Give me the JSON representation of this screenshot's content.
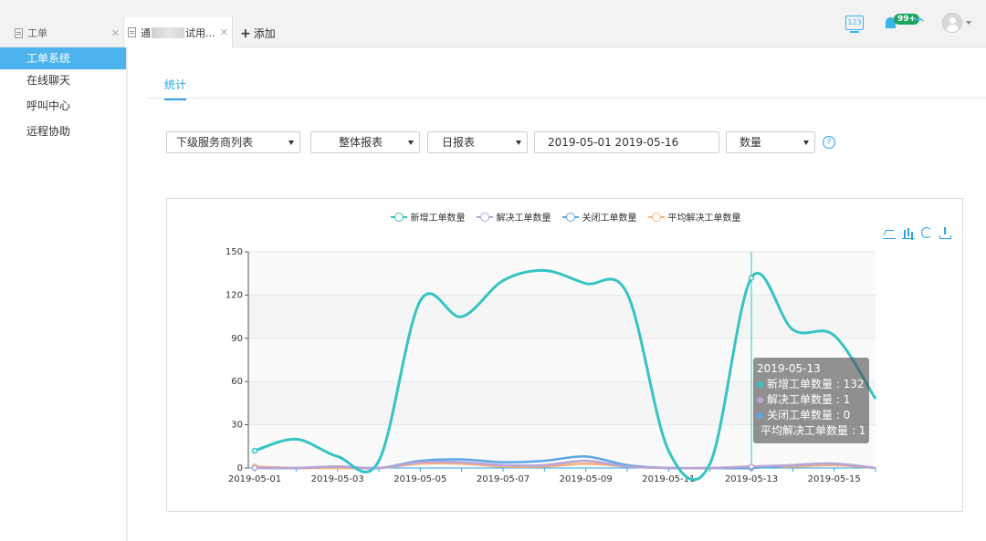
{
  "tabs": [
    {
      "label": "工单",
      "close": "✕"
    },
    {
      "label_prefix": "通",
      "label_suffix": "试用...",
      "close": "✕"
    }
  ],
  "add_tab": {
    "icon": "+",
    "label": "添加"
  },
  "header": {
    "keypad_text": "123",
    "badge": "99+"
  },
  "sidebar": {
    "items": [
      {
        "label": "工单系统",
        "active": true
      },
      {
        "label": "在线聊天"
      },
      {
        "label": "呼叫中心"
      },
      {
        "label": "远程协助"
      }
    ]
  },
  "subtabs": [
    {
      "label": "统计"
    }
  ],
  "filters": {
    "provider": "下级服务商列表",
    "report_scope": "整体报表",
    "report_period": "日报表",
    "date_range": "2019-05-01 2019-05-16",
    "metric": "数量",
    "help": "?"
  },
  "colors": {
    "new": "#36c3c3",
    "resolved": "#b8a4d8",
    "closed": "#5ba7e6",
    "avg": "#f8b07a",
    "accent": "#2ba4e8"
  },
  "chart_data": {
    "type": "line",
    "x": [
      "2019-05-01",
      "2019-05-02",
      "2019-05-03",
      "2019-05-04",
      "2019-05-05",
      "2019-05-06",
      "2019-05-07",
      "2019-05-08",
      "2019-05-09",
      "2019-05-10",
      "2019-05-11",
      "2019-05-12",
      "2019-05-13",
      "2019-05-14",
      "2019-05-15",
      "2019-05-16"
    ],
    "xticks": [
      "2019-05-01",
      "2019-05-03",
      "2019-05-05",
      "2019-05-07",
      "2019-05-09",
      "2019-05-11",
      "2019-05-13",
      "2019-05-15"
    ],
    "yticks": [
      0,
      30,
      60,
      90,
      120,
      150
    ],
    "ylim": [
      0,
      150
    ],
    "grid": true,
    "legend_position": "top-center",
    "series": [
      {
        "name": "新增工单数量",
        "color_key": "new",
        "values": [
          12,
          20,
          8,
          5,
          116,
          105,
          130,
          137,
          128,
          121,
          12,
          3,
          132,
          96,
          92,
          48
        ]
      },
      {
        "name": "解决工单数量",
        "color_key": "resolved",
        "values": [
          0,
          0,
          1,
          0,
          4,
          4,
          2,
          2,
          5,
          1,
          0,
          0,
          1,
          2,
          3,
          0
        ]
      },
      {
        "name": "关闭工单数量",
        "color_key": "closed",
        "values": [
          0,
          0,
          1,
          0,
          5,
          6,
          4,
          5,
          8,
          2,
          0,
          0,
          0,
          2,
          3,
          0
        ]
      },
      {
        "name": "平均解决工单数量",
        "color_key": "avg",
        "values": [
          1,
          0,
          0,
          0,
          3,
          3,
          1,
          1,
          3,
          1,
          0,
          0,
          1,
          1,
          2,
          0
        ]
      }
    ],
    "tooltip": {
      "date": "2019-05-13",
      "rows": [
        {
          "text": "新增工单数量 : 132",
          "color_key": "new"
        },
        {
          "text": "解决工单数量 : 1",
          "color_key": "resolved"
        },
        {
          "text": "关闭工单数量 : 0",
          "color_key": "closed"
        },
        {
          "text": "平均解决工单数量 : 1",
          "color_key": "avg"
        }
      ]
    }
  }
}
